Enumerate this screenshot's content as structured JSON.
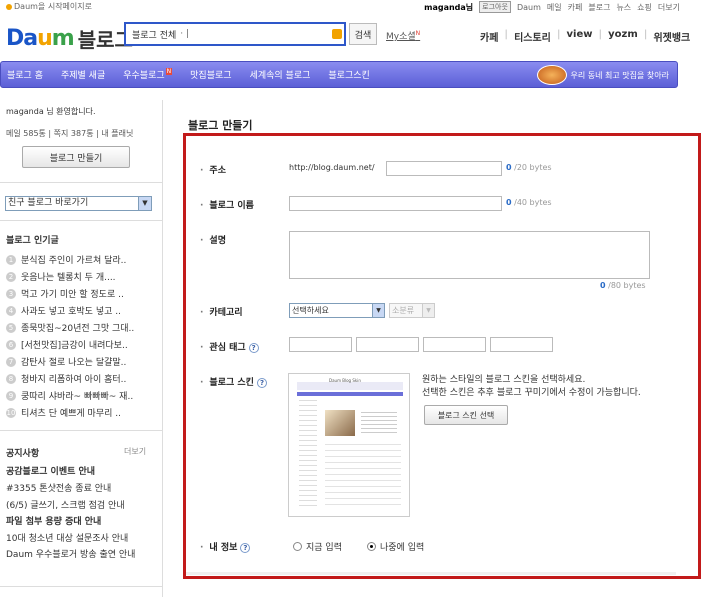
{
  "topbar": {
    "sethome": "Daum을 시작페이지로",
    "user": "maganda님",
    "logout": "로그아웃",
    "links": [
      "Daum",
      "메일",
      "카페",
      "블로그",
      "뉴스",
      "쇼핑",
      "더보기"
    ]
  },
  "header": {
    "logo_daum": "Daum",
    "logo_blog": "블로그",
    "search_scope": "블로그 전체",
    "search_caret": "· |",
    "search_button": "검색",
    "my_sub": "My소셜",
    "my_sub_badge": "N",
    "services": [
      "카페",
      "티스토리",
      "view",
      "yozm",
      "위젯뱅크"
    ]
  },
  "nav": {
    "items": [
      "블로그 홈",
      "주제별 새글",
      "우수블로그",
      "맛집블로그",
      "세계속의 블로그",
      "블로그스킨"
    ],
    "new_badge": "N",
    "promo": "우리 동네 최고 맛집을 찾아라"
  },
  "sidebar": {
    "welcome_user": "maganda",
    "welcome_rest": " 님 환영합니다.",
    "counts": "메일 585통 | 쪽지 387통 | 내 플래닛",
    "make_blog": "블로그 만들기",
    "friend_select": "친구 블로그 바로가기",
    "popular_title": "블로그 인기글",
    "popular": [
      "분식집 주인이 가르쳐 달라..",
      "웃음나는 텔롱치 두 개....",
      "먹고 가기 미안 할 정도로 ..",
      "사과도 넣고 호박도 넣고 ..",
      "종묵맛집~20년전 그맛 그대..",
      "[서천맛집]금강이 내려다보..",
      "감탄사 절로 나오는 달걀말..",
      "청바지 리폼하여 아이 홈터..",
      "쿵따리 샤바라~ 빠빠빠~ 재..",
      "티셔츠 단 예쁘게 마무리 .."
    ],
    "notice_title": "공지사항",
    "notice_more": "더보기",
    "notices": [
      {
        "text": "공감블로그 이벤트 안내",
        "bold": true
      },
      {
        "text": "#3355 톤샷전송 종료 안내",
        "bold": false
      },
      {
        "text": "(6/5) 글쓰기, 스크랩 점검 안내",
        "bold": false
      },
      {
        "text": "파일 첨부 용량 증대 안내",
        "bold": true
      },
      {
        "text": "10대 청소년 대상 설문조사 안내",
        "bold": false
      },
      {
        "text": "Daum 우수블로거 방송 출연 안내",
        "bold": false
      }
    ]
  },
  "form": {
    "page_title": "블로그 만들기",
    "address_label": "주소",
    "address_prefix": "http://blog.daum.net/",
    "address_count": "0",
    "address_max": "/20 bytes",
    "name_label": "블로그 이름",
    "name_count": "0",
    "name_max": "/40 bytes",
    "desc_label": "설명",
    "desc_count": "0",
    "desc_max": "/80 bytes",
    "category_label": "카테고리",
    "category_select": "선택하세요",
    "subcategory_select": "소분류",
    "tags_label": "관심 태그",
    "skin_label": "블로그 스킨",
    "skin_desc_1": "원하는 스타일의 블로그 스킨을 선택하세요.",
    "skin_desc_2": "선택한 스킨은 추후 블로그 꾸미기에서 수정이 가능합니다.",
    "skin_button": "블로그 스킨 선택",
    "skin_preview_title": "Daum Blog Skin",
    "info_label": "내 정보",
    "info_opt_now": "지금 입력",
    "info_opt_later": "나중에 입력",
    "help_icon": "?"
  },
  "colors": {
    "nav": "#6b6fd9",
    "highlight": "#c21a1a",
    "search": "#2e57c9"
  }
}
